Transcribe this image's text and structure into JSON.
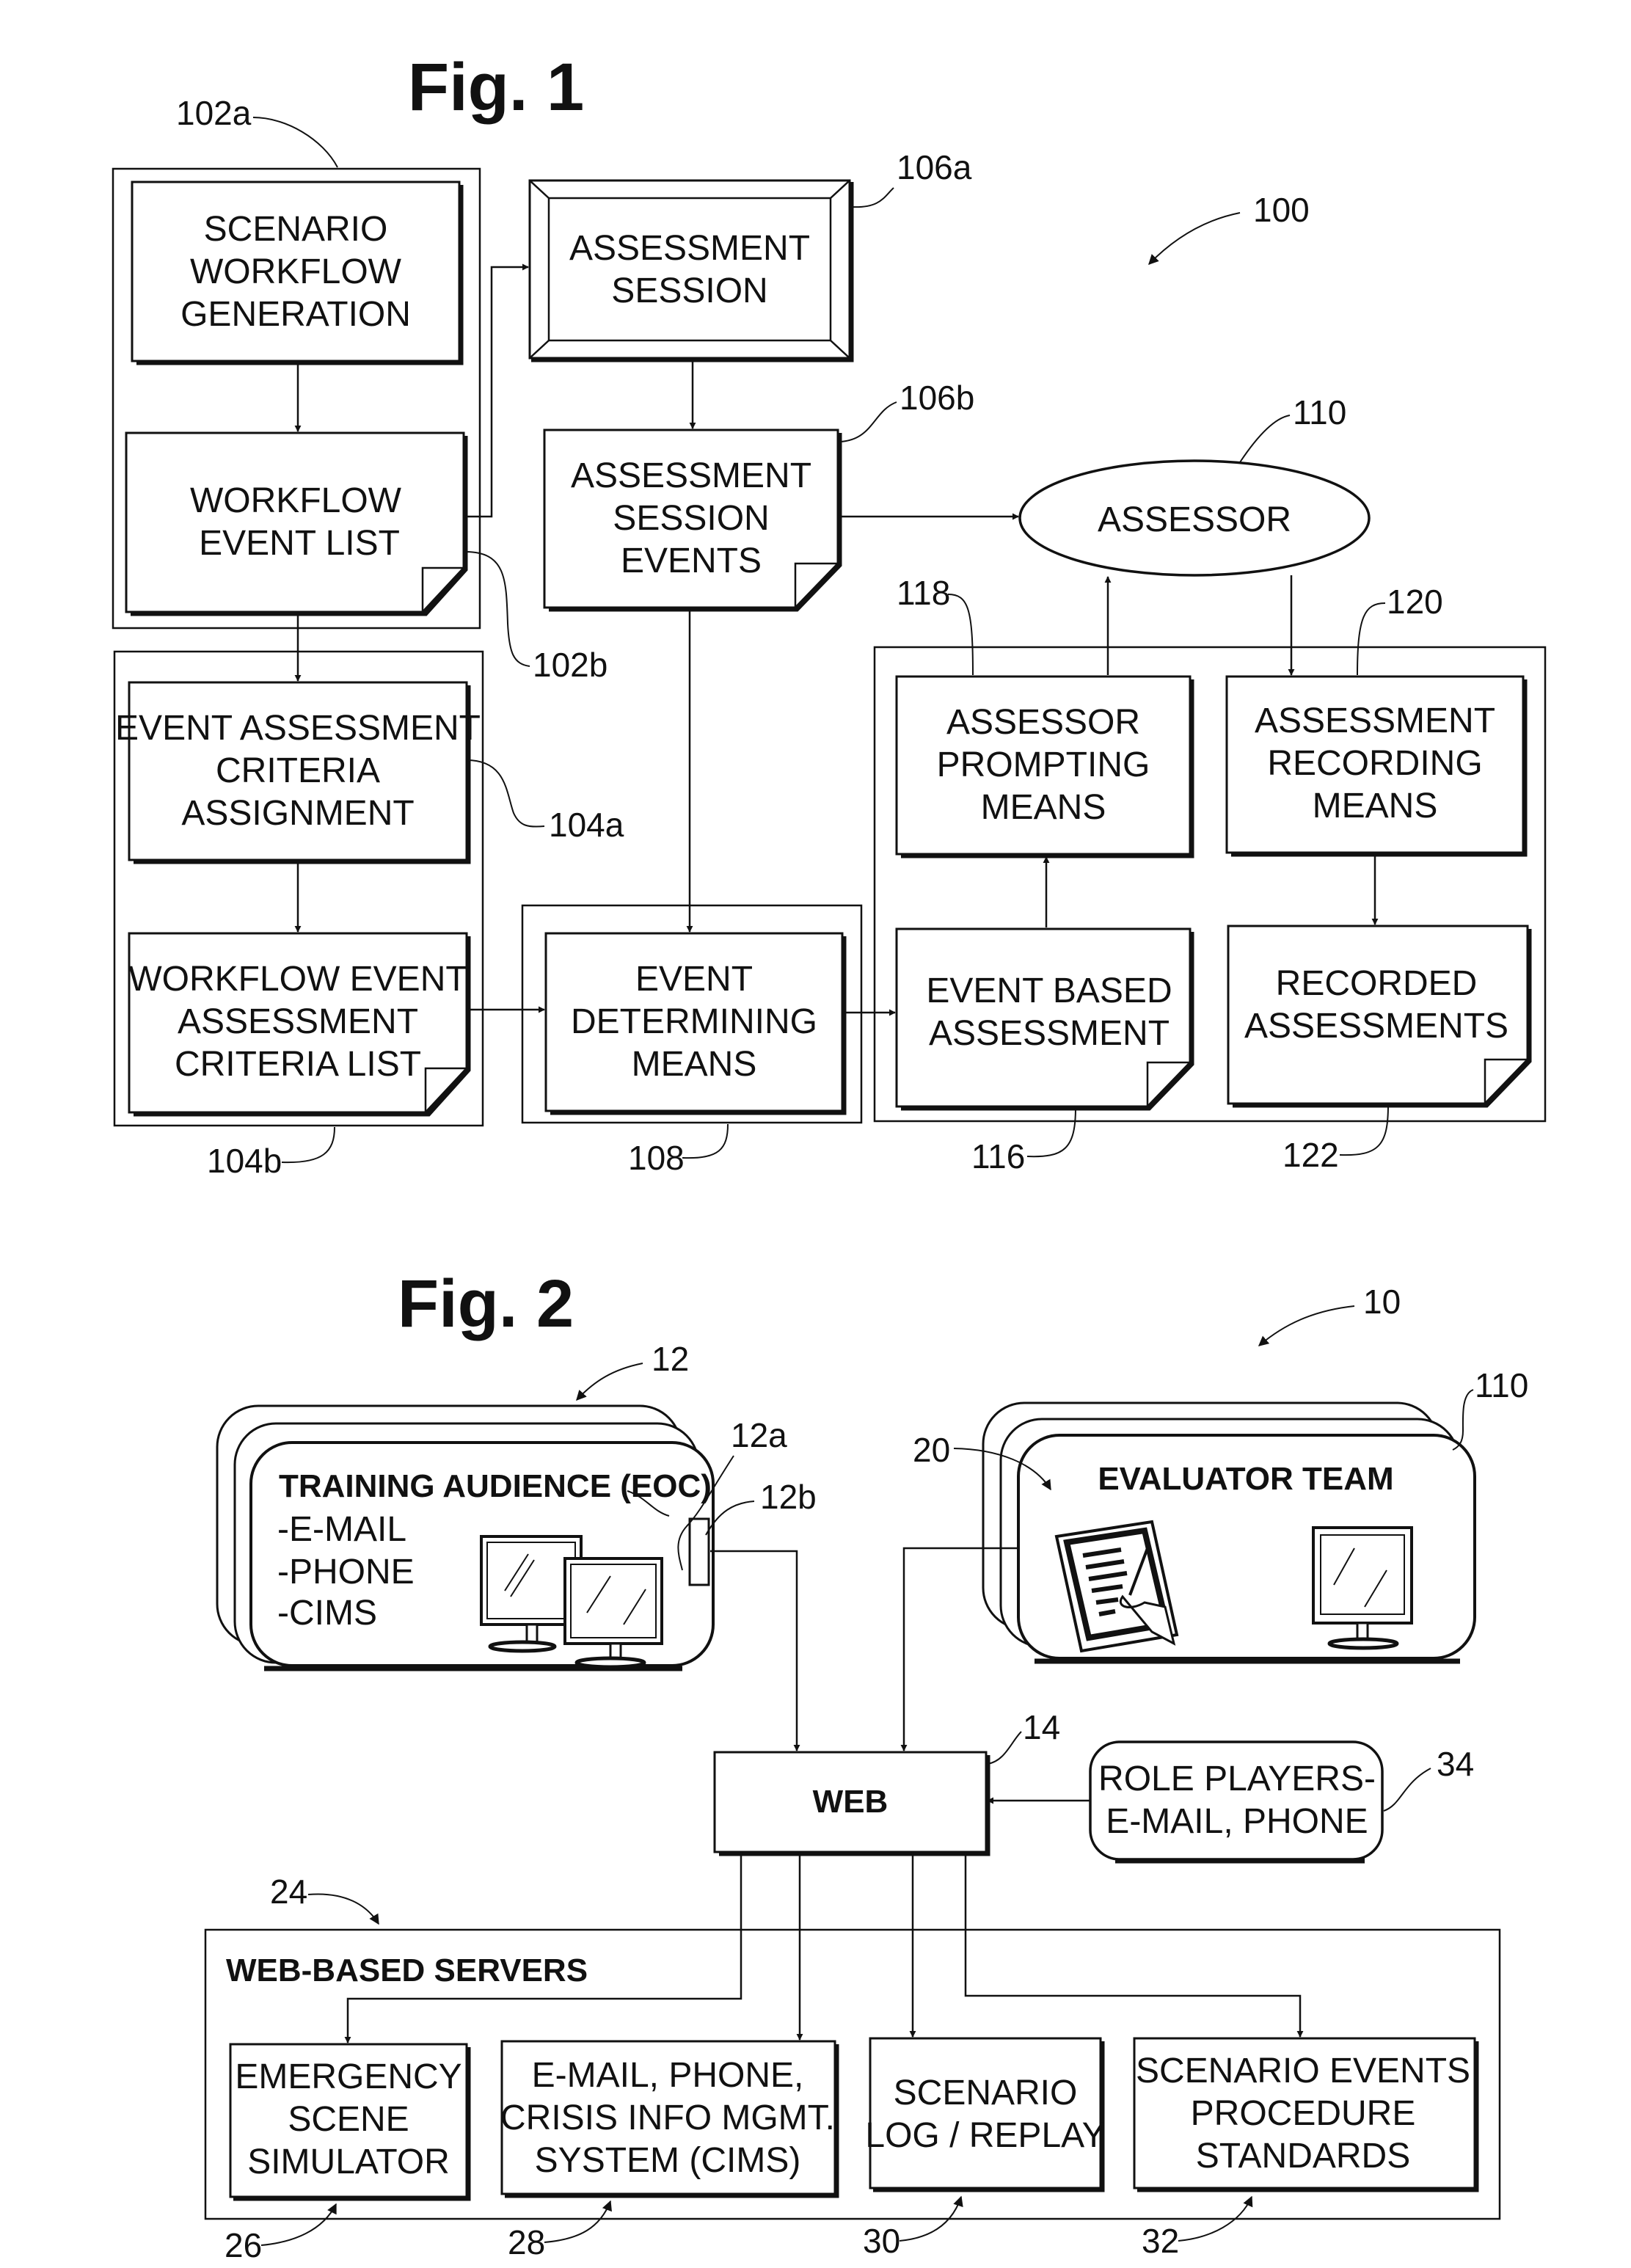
{
  "fig1": {
    "title": "Fig. 1",
    "system_ref": "100",
    "scenario_group": {
      "ref": "102a",
      "scenario_workflow_generation": [
        "SCENARIO",
        "WORKFLOW",
        "GENERATION"
      ],
      "workflow_event_list": {
        "ref": "102b",
        "lines": [
          "WORKFLOW",
          "EVENT LIST"
        ]
      }
    },
    "criteria_group": {
      "event_assessment_criteria_assignment": {
        "ref": "104a",
        "lines": [
          "EVENT ASSESSMENT",
          "CRITERIA",
          "ASSIGNMENT"
        ]
      },
      "workflow_event_assessment_criteria_list": {
        "ref": "104b",
        "lines": [
          "WORKFLOW EVENT",
          "ASSESSMENT",
          "CRITERIA LIST"
        ]
      }
    },
    "assessment_session": {
      "ref": "106a",
      "lines": [
        "ASSESSMENT",
        "SESSION"
      ]
    },
    "assessment_session_events": {
      "ref": "106b",
      "lines": [
        "ASSESSMENT",
        "SESSION",
        "EVENTS"
      ]
    },
    "event_determining_means": {
      "ref": "108",
      "lines": [
        "EVENT",
        "DETERMINING",
        "MEANS"
      ]
    },
    "assessor": {
      "ref": "110",
      "label": "ASSESSOR"
    },
    "assessor_prompting_means": {
      "ref": "118",
      "lines": [
        "ASSESSOR",
        "PROMPTING",
        "MEANS"
      ]
    },
    "assessment_recording_means": {
      "ref": "120",
      "lines": [
        "ASSESSMENT",
        "RECORDING",
        "MEANS"
      ]
    },
    "event_based_assessment": {
      "ref": "116",
      "lines": [
        "EVENT BASED",
        "ASSESSMENT"
      ]
    },
    "recorded_assessments": {
      "ref": "122",
      "lines": [
        "RECORDED",
        "ASSESSMENTS"
      ]
    }
  },
  "fig2": {
    "title": "Fig. 2",
    "system_ref": "10",
    "training_audience": {
      "ref": "12",
      "title": "TRAINING AUDIENCE (EOC)",
      "items": [
        "-E-MAIL",
        "-PHONE",
        "-CIMS"
      ],
      "ref_a": "12a",
      "ref_b": "12b"
    },
    "evaluator_team": {
      "ref": "20",
      "stack_ref": "110",
      "title": "EVALUATOR TEAM"
    },
    "web": {
      "ref": "14",
      "label": "WEB"
    },
    "role_players": {
      "ref": "34",
      "lines": [
        "ROLE PLAYERS-",
        "E-MAIL, PHONE"
      ]
    },
    "servers": {
      "ref": "24",
      "title": "WEB-BASED SERVERS",
      "emergency_scene_simulator": {
        "ref": "26",
        "lines": [
          "EMERGENCY",
          "SCENE",
          "SIMULATOR"
        ]
      },
      "cims": {
        "ref": "28",
        "lines": [
          "E-MAIL, PHONE,",
          "CRISIS INFO MGMT.",
          "SYSTEM (CIMS)"
        ]
      },
      "log_replay": {
        "ref": "30",
        "lines": [
          "SCENARIO",
          "LOG / REPLAY"
        ]
      },
      "procedure_standards": {
        "ref": "32",
        "lines": [
          "SCENARIO EVENTS",
          "PROCEDURE",
          "STANDARDS"
        ]
      }
    }
  }
}
